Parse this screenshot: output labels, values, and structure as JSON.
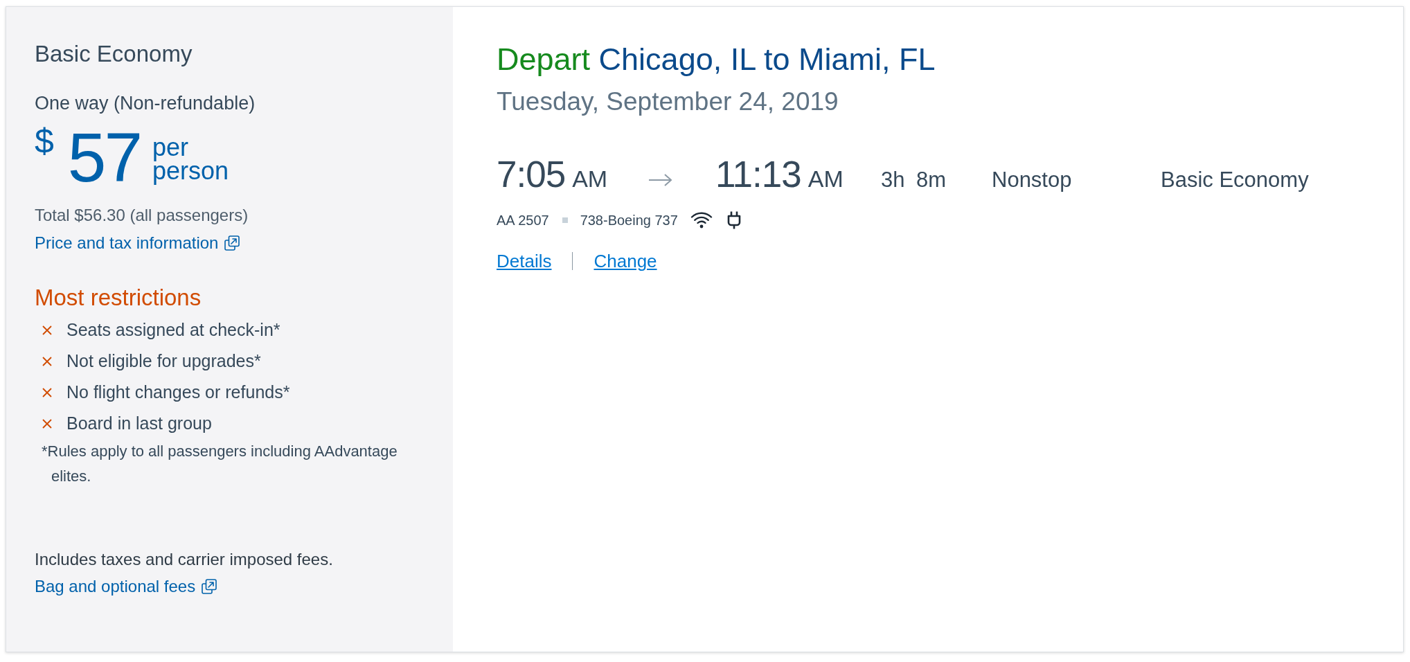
{
  "fare_panel": {
    "title": "Basic Economy",
    "trip_type": "One way (Non-refundable)",
    "price": {
      "currency": "$",
      "amount": "57",
      "unit": "per person"
    },
    "total": "Total $56.30 (all passengers)",
    "price_link": "Price and tax information",
    "restrictions_title": "Most restrictions",
    "restrictions": [
      "Seats assigned at check-in*",
      "Not eligible for upgrades*",
      "No flight changes or refunds*",
      "Board in last group"
    ],
    "footnote": "*Rules apply to all passengers including AAdvantage elites.",
    "fees_note": "Includes taxes and carrier imposed fees.",
    "fees_link": "Bag and optional fees"
  },
  "flight": {
    "direction": "Depart",
    "route": "Chicago, IL to Miami, FL",
    "date": "Tuesday, September 24, 2019",
    "departure": {
      "time": "7:05",
      "period": "AM"
    },
    "arrival": {
      "time": "11:13",
      "period": "AM"
    },
    "duration": "3h 8m",
    "stops": "Nonstop",
    "cabin": "Basic Economy",
    "flight_number": "AA 2507",
    "aircraft": "738-Boeing 737",
    "amenities": [
      {
        "kind": "wifi"
      },
      {
        "kind": "power"
      }
    ],
    "links": [
      "Details",
      "Change"
    ]
  }
}
